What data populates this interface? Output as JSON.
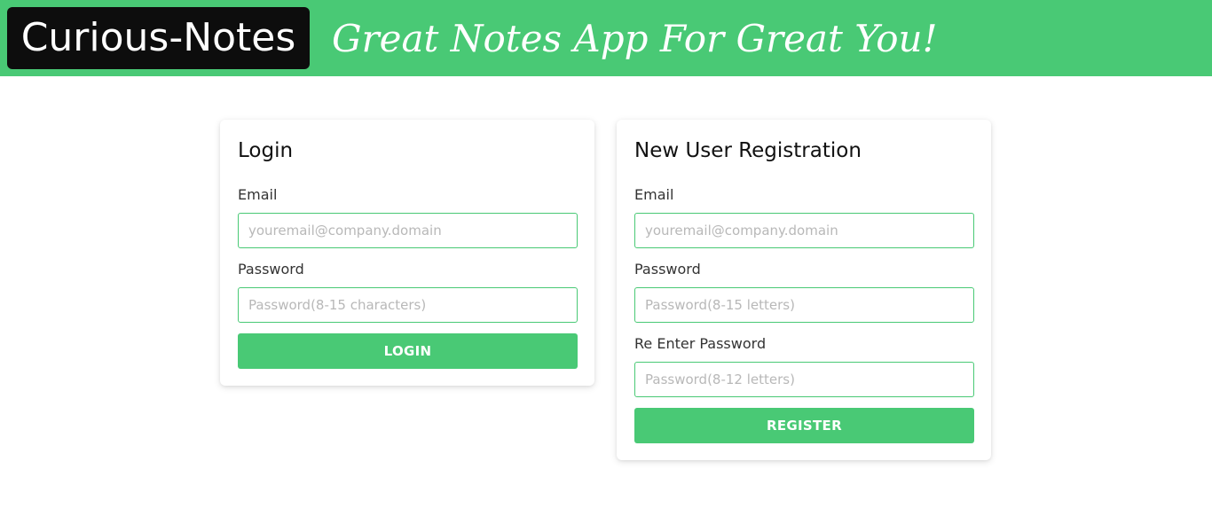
{
  "header": {
    "brand": "Curious-Notes",
    "tagline": "Great Notes App For Great You!"
  },
  "login": {
    "title": "Login",
    "email_label": "Email",
    "email_placeholder": "youremail@company.domain",
    "password_label": "Password",
    "password_placeholder": "Password(8-15 characters)",
    "button_label": "LOGIN"
  },
  "register": {
    "title": "New User Registration",
    "email_label": "Email",
    "email_placeholder": "youremail@company.domain",
    "password_label": "Password",
    "password_placeholder": "Password(8-15 letters)",
    "reenter_label": "Re Enter Password",
    "reenter_placeholder": "Password(8-12 letters)",
    "button_label": "REGISTER"
  },
  "colors": {
    "accent": "#49c975",
    "brand_bg": "#0d0d0d"
  }
}
